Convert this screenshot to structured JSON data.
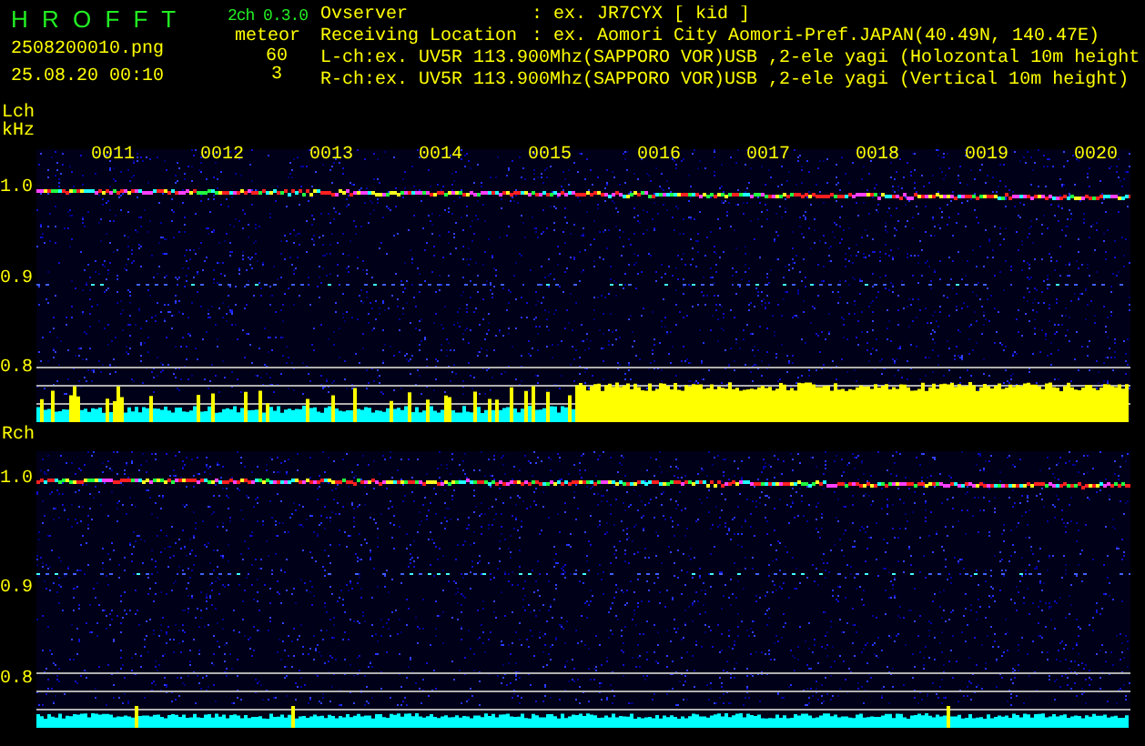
{
  "header": {
    "app_title": "H R O F F T",
    "version": "2ch 0.3.0",
    "filename": "2508200010.png",
    "datetime": "25.08.20 00:10",
    "meteor_label": "meteor",
    "counts": [
      "60",
      "3"
    ],
    "info": [
      {
        "label": "Ovserver",
        "value": ": ex. JR7CYX [ kid ]"
      },
      {
        "label": "Receiving Location",
        "value": ": ex. Aomori City Aomori-Pref.JAPAN(40.49N, 140.47E)"
      }
    ],
    "channel_lines": [
      "L-ch:ex. UV5R 113.900Mhz(SAPPORO VOR)USB ,2-ele yagi (Holozontal 10m height",
      "R-ch:ex. UV5R 113.900Mhz(SAPPORO VOR)USB ,2-ele yagi (Vertical 10m height)"
    ]
  },
  "channels": [
    {
      "label": "Lch",
      "unit": "kHz",
      "time_labels": [
        "0011",
        "0012",
        "0013",
        "0014",
        "0015",
        "0016",
        "0017",
        "0018",
        "0019",
        "0020"
      ],
      "yticks": [
        "1.0",
        "0.9",
        "0.8"
      ]
    },
    {
      "label": "Rch",
      "yticks": [
        "1.0",
        "0.9",
        "0.8"
      ]
    }
  ]
}
